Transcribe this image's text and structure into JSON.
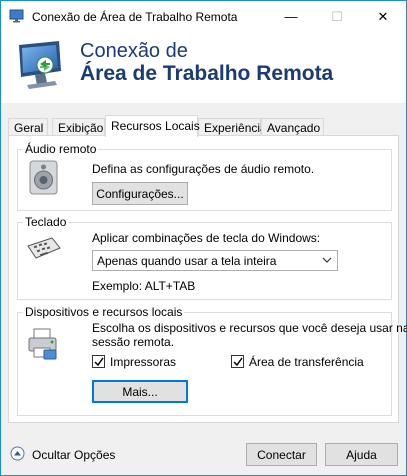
{
  "window": {
    "title": "Conexão de Área de Trabalho Remota",
    "min_glyph": "—",
    "max_glyph": "☐",
    "close_glyph": "✕"
  },
  "banner": {
    "line1": "Conexão de",
    "line2": "Área de Trabalho Remota"
  },
  "tabs": [
    {
      "label": "Geral",
      "active": false
    },
    {
      "label": "Exibição",
      "active": false
    },
    {
      "label": "Recursos Locais",
      "active": true
    },
    {
      "label": "Experiência",
      "active": false
    },
    {
      "label": "Avançado",
      "active": false
    }
  ],
  "audio": {
    "legend": "Áudio remoto",
    "description": "Defina as configurações de áudio remoto.",
    "settings_button": "Configurações..."
  },
  "keyboard": {
    "legend": "Teclado",
    "description": "Aplicar combinações de tecla do Windows:",
    "dropdown_value": "Apenas quando usar a tela inteira",
    "example": "Exemplo: ALT+TAB"
  },
  "devices": {
    "legend": "Dispositivos e recursos locais",
    "description_line1": "Escolha os dispositivos e recursos que você deseja usar na",
    "description_line2": "sessão remota.",
    "printers_label": "Impressoras",
    "printers_checked": true,
    "clipboard_label": "Área de transferência",
    "clipboard_checked": true,
    "more_button": "Mais..."
  },
  "footer": {
    "hide_options": "Ocultar Opções",
    "connect": "Conectar",
    "help": "Ajuda"
  },
  "colors": {
    "banner_text": "#1b3c72",
    "focus_border": "#0078d7",
    "window_border": "#1a8dd8"
  }
}
